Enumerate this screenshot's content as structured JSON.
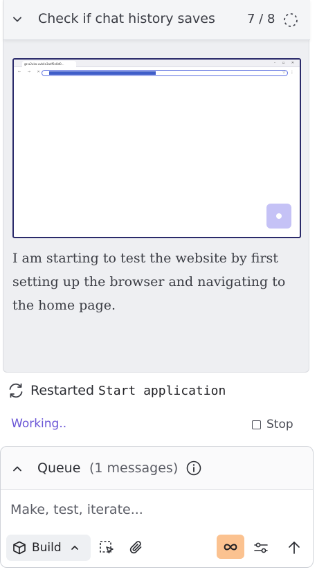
{
  "task": {
    "title": "Check if chat history saves",
    "progress": "7 / 8",
    "progress_value": 0.875
  },
  "screenshot": {
    "tab_label": "gz.a2uka-uvb4e3adf5n8d0...",
    "url_selected": true
  },
  "narration": "I am starting to test the website by first setting up the browser and navigating to the home page.",
  "status": {
    "restarted_label": "Restarted",
    "restarted_target": "Start application",
    "working_label": "Working..",
    "stop_label": "Stop"
  },
  "queue": {
    "title": "Queue",
    "count": "(1 messages)"
  },
  "composer": {
    "placeholder": "Make, test, iterate...",
    "build_label": "Build"
  },
  "colors": {
    "accent": "#6a56d6",
    "infinity_bg": "#fbc290",
    "float_btn": "#c5c2f6"
  },
  "icons": [
    "chevron-down-icon",
    "progress-spinner-icon",
    "restart-icon",
    "stop-icon",
    "chevron-up-icon",
    "info-icon",
    "cube-icon",
    "select-element-icon",
    "paperclip-icon",
    "infinity-icon",
    "sliders-icon",
    "send-arrow-icon"
  ]
}
